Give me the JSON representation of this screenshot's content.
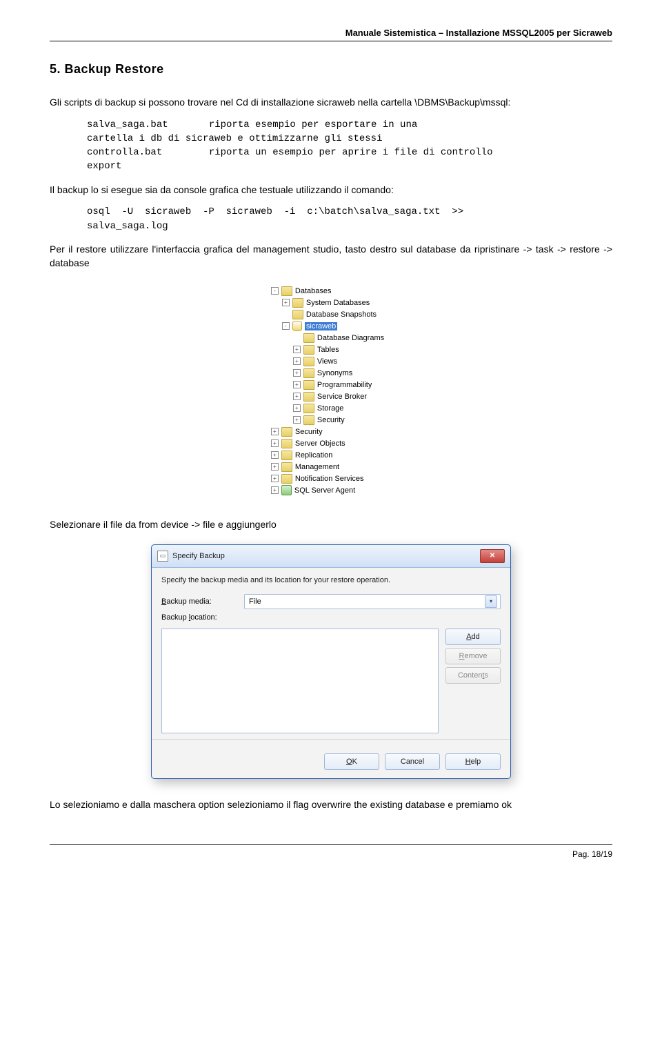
{
  "header": {
    "title": "Manuale Sistemistica – Installazione MSSQL2005 per Sicraweb"
  },
  "section": {
    "number": "5.",
    "title": "Backup Restore"
  },
  "intro": "Gli scripts di backup si possono trovare nel Cd di installazione sicraweb nella cartella \\DBMS\\Backup\\mssql:",
  "scripts": {
    "row1_name": "salva_saga.bat",
    "row1_desc": "riporta esempio per esportare in una",
    "row2": "cartella i db di sicraweb e ottimizzarne gli stessi",
    "row3_name": "controlla.bat",
    "row3_desc": "riporta un esempio per aprire i file di controllo",
    "row4": "export"
  },
  "backup_text": "Il backup lo si esegue sia da console grafica che testuale utilizzando il comando:",
  "command": {
    "line1": "osql  -U  sicraweb  -P  sicraweb  -i  c:\\batch\\salva_saga.txt  >>",
    "line2": "salva_saga.log"
  },
  "restore_text": "Per il restore utilizzare l'interfaccia grafica del management studio, tasto destro sul database da ripristinare -> task -> restore -> database",
  "tree": {
    "items": [
      {
        "depth": 1,
        "exp": "-",
        "icon": "folder",
        "label": "Databases"
      },
      {
        "depth": 2,
        "exp": "+",
        "icon": "folder",
        "label": "System Databases"
      },
      {
        "depth": 2,
        "exp": " ",
        "icon": "folder",
        "label": "Database Snapshots"
      },
      {
        "depth": 2,
        "exp": "-",
        "icon": "db",
        "label": "sicraweb",
        "selected": true
      },
      {
        "depth": 3,
        "exp": " ",
        "icon": "folder",
        "label": "Database Diagrams"
      },
      {
        "depth": 3,
        "exp": "+",
        "icon": "folder",
        "label": "Tables"
      },
      {
        "depth": 3,
        "exp": "+",
        "icon": "folder",
        "label": "Views"
      },
      {
        "depth": 3,
        "exp": "+",
        "icon": "folder",
        "label": "Synonyms"
      },
      {
        "depth": 3,
        "exp": "+",
        "icon": "folder",
        "label": "Programmability"
      },
      {
        "depth": 3,
        "exp": "+",
        "icon": "folder",
        "label": "Service Broker"
      },
      {
        "depth": 3,
        "exp": "+",
        "icon": "folder",
        "label": "Storage"
      },
      {
        "depth": 3,
        "exp": "+",
        "icon": "folder",
        "label": "Security"
      },
      {
        "depth": 1,
        "exp": "+",
        "icon": "folder",
        "label": "Security"
      },
      {
        "depth": 1,
        "exp": "+",
        "icon": "folder",
        "label": "Server Objects"
      },
      {
        "depth": 1,
        "exp": "+",
        "icon": "folder",
        "label": "Replication"
      },
      {
        "depth": 1,
        "exp": "+",
        "icon": "folder",
        "label": "Management"
      },
      {
        "depth": 1,
        "exp": "+",
        "icon": "folder",
        "label": "Notification Services"
      },
      {
        "depth": 1,
        "exp": "+",
        "icon": "agent",
        "label": "SQL Server Agent"
      }
    ]
  },
  "select_text": "Selezionare il file da from device -> file e aggiungerlo",
  "dialog": {
    "title": "Specify Backup",
    "instruction": "Specify the backup media and its location for your restore operation.",
    "media_label_pre": "B",
    "media_label_post": "ackup media:",
    "media_value": "File",
    "location_label_pre": "Backup ",
    "location_label_u": "l",
    "location_label_post": "ocation:",
    "btn_add": "Add",
    "btn_remove": "Remove",
    "btn_contents": "Contents",
    "btn_ok": "OK",
    "btn_cancel": "Cancel",
    "btn_help": "Help",
    "ok_u": "O",
    "ok_post": "K",
    "help_u": "H",
    "help_post": "elp",
    "add_u": "A",
    "add_post": "dd",
    "remove_u": "R",
    "remove_post": "emove",
    "contents_pre": "Conten",
    "contents_u": "t",
    "contents_post": "s"
  },
  "final_text": "Lo selezioniamo e dalla maschera option selezioniamo il flag overwrire the existing database e premiamo ok",
  "footer": "Pag. 18/19"
}
